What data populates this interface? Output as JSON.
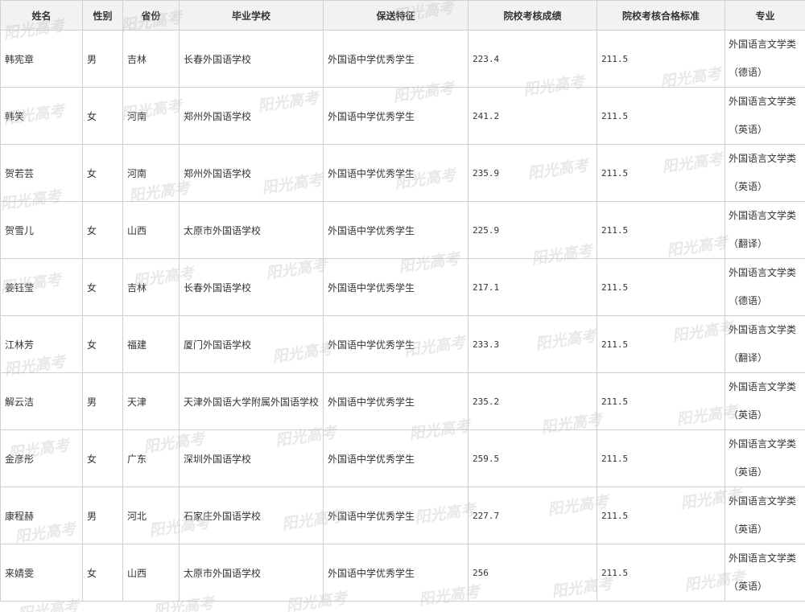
{
  "headers": [
    "姓名",
    "性别",
    "省份",
    "毕业学校",
    "保送特征",
    "院校考核成绩",
    "院校考核合格标准",
    "专业"
  ],
  "rows": [
    {
      "name": "韩宪章",
      "gender": "男",
      "province": "吉林",
      "school": "长春外国语学校",
      "feature": "外国语中学优秀学生",
      "score": "223.4",
      "standard": "211.5",
      "major_line1": "外国语言文学类",
      "major_line2": "（德语）"
    },
    {
      "name": "韩笑",
      "gender": "女",
      "province": "河南",
      "school": "郑州外国语学校",
      "feature": "外国语中学优秀学生",
      "score": "241.2",
      "standard": "211.5",
      "major_line1": "外国语言文学类",
      "major_line2": "（英语）"
    },
    {
      "name": "贺若芸",
      "gender": "女",
      "province": "河南",
      "school": "郑州外国语学校",
      "feature": "外国语中学优秀学生",
      "score": "235.9",
      "standard": "211.5",
      "major_line1": "外国语言文学类",
      "major_line2": "（英语）"
    },
    {
      "name": "贺雪儿",
      "gender": "女",
      "province": "山西",
      "school": "太原市外国语学校",
      "feature": "外国语中学优秀学生",
      "score": "225.9",
      "standard": "211.5",
      "major_line1": "外国语言文学类",
      "major_line2": "（翻译）"
    },
    {
      "name": "姜钰莹",
      "gender": "女",
      "province": "吉林",
      "school": "长春外国语学校",
      "feature": "外国语中学优秀学生",
      "score": "217.1",
      "standard": "211.5",
      "major_line1": "外国语言文学类",
      "major_line2": "（德语）"
    },
    {
      "name": "江林芳",
      "gender": "女",
      "province": "福建",
      "school": "厦门外国语学校",
      "feature": "外国语中学优秀学生",
      "score": "233.3",
      "standard": "211.5",
      "major_line1": "外国语言文学类",
      "major_line2": "（翻译）"
    },
    {
      "name": "解云洁",
      "gender": "男",
      "province": "天津",
      "school": "天津外国语大学附属外国语学校",
      "feature": "外国语中学优秀学生",
      "score": "235.2",
      "standard": "211.5",
      "major_line1": "外国语言文学类",
      "major_line2": "（英语）"
    },
    {
      "name": "金彦彤",
      "gender": "女",
      "province": "广东",
      "school": "深圳外国语学校",
      "feature": "外国语中学优秀学生",
      "score": "259.5",
      "standard": "211.5",
      "major_line1": "外国语言文学类",
      "major_line2": "（英语）"
    },
    {
      "name": "康程赫",
      "gender": "男",
      "province": "河北",
      "school": "石家庄外国语学校",
      "feature": "外国语中学优秀学生",
      "score": "227.7",
      "standard": "211.5",
      "major_line1": "外国语言文学类",
      "major_line2": "（英语）"
    },
    {
      "name": "来婧雯",
      "gender": "女",
      "province": "山西",
      "school": "太原市外国语学校",
      "feature": "外国语中学优秀学生",
      "score": "256",
      "standard": "211.5",
      "major_line1": "外国语言文学类",
      "major_line2": "（英语）"
    }
  ],
  "watermark_text": "阳光高考"
}
